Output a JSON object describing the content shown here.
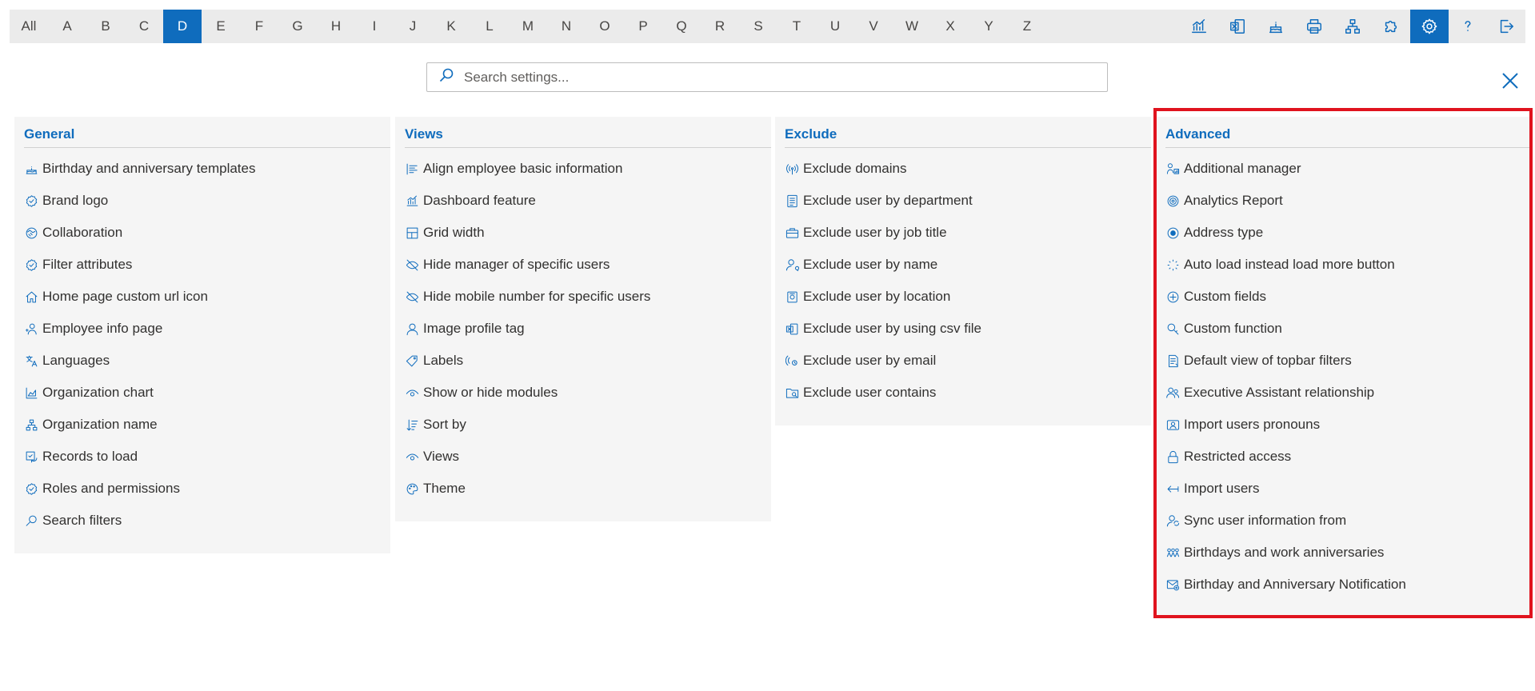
{
  "alphabet": {
    "letters": [
      "All",
      "A",
      "B",
      "C",
      "D",
      "E",
      "F",
      "G",
      "H",
      "I",
      "J",
      "K",
      "L",
      "M",
      "N",
      "O",
      "P",
      "Q",
      "R",
      "S",
      "T",
      "U",
      "V",
      "W",
      "X",
      "Y",
      "Z"
    ],
    "active": "D"
  },
  "toolbar": {
    "icons": [
      "analytics-icon",
      "excel-export-icon",
      "birthday-cake-icon",
      "print-icon",
      "org-chart-icon",
      "puzzle-icon",
      "settings-gear-icon",
      "help-icon",
      "sign-out-icon"
    ],
    "active": "settings-gear-icon"
  },
  "search": {
    "placeholder": "Search settings..."
  },
  "colors": {
    "accent": "#0f6cbd",
    "highlight": "#e0131e",
    "panel_bg": "#f5f5f5"
  },
  "sections": [
    {
      "title": "General",
      "items": [
        {
          "label": "Birthday and anniversary templates",
          "icon": "cake-icon"
        },
        {
          "label": "Brand logo",
          "icon": "badge-check-icon"
        },
        {
          "label": "Collaboration",
          "icon": "handshake-icon"
        },
        {
          "label": "Filter attributes",
          "icon": "badge-check-icon"
        },
        {
          "label": "Home page custom url icon",
          "icon": "home-icon"
        },
        {
          "label": "Employee info page",
          "icon": "person-link-icon"
        },
        {
          "label": "Languages",
          "icon": "translate-icon"
        },
        {
          "label": "Organization chart",
          "icon": "area-chart-icon"
        },
        {
          "label": "Organization name",
          "icon": "org-chart-icon"
        },
        {
          "label": "Records to load",
          "icon": "records-refresh-icon"
        },
        {
          "label": "Roles and permissions",
          "icon": "badge-check-icon"
        },
        {
          "label": "Search filters",
          "icon": "search-icon"
        }
      ]
    },
    {
      "title": "Views",
      "items": [
        {
          "label": "Align employee basic information",
          "icon": "align-left-icon"
        },
        {
          "label": "Dashboard feature",
          "icon": "analytics-icon"
        },
        {
          "label": "Grid width",
          "icon": "grid-icon"
        },
        {
          "label": "Hide manager of specific users",
          "icon": "eye-off-icon"
        },
        {
          "label": "Hide mobile number for specific users",
          "icon": "eye-off-icon"
        },
        {
          "label": "Image profile tag",
          "icon": "person-icon"
        },
        {
          "label": "Labels",
          "icon": "tag-icon"
        },
        {
          "label": "Show or hide modules",
          "icon": "eye-icon"
        },
        {
          "label": "Sort by",
          "icon": "sort-icon"
        },
        {
          "label": "Views",
          "icon": "eye-icon"
        },
        {
          "label": "Theme",
          "icon": "palette-icon"
        }
      ]
    },
    {
      "title": "Exclude",
      "items": [
        {
          "label": "Exclude domains",
          "icon": "broadcast-icon"
        },
        {
          "label": "Exclude user by department",
          "icon": "document-icon"
        },
        {
          "label": "Exclude user by job title",
          "icon": "briefcase-icon"
        },
        {
          "label": "Exclude user by name",
          "icon": "person-search-icon"
        },
        {
          "label": "Exclude user by location",
          "icon": "building-icon"
        },
        {
          "label": "Exclude user by using csv file",
          "icon": "excel-icon"
        },
        {
          "label": "Exclude user by email",
          "icon": "broadcast-email-icon"
        },
        {
          "label": "Exclude user contains",
          "icon": "folder-search-icon"
        }
      ]
    },
    {
      "title": "Advanced",
      "items": [
        {
          "label": "Additional manager",
          "icon": "people-chart-icon"
        },
        {
          "label": "Analytics Report",
          "icon": "target-icon"
        },
        {
          "label": "Address type",
          "icon": "radio-icon"
        },
        {
          "label": "Auto load instead load more button",
          "icon": "spinner-icon"
        },
        {
          "label": "Custom fields",
          "icon": "add-circle-icon"
        },
        {
          "label": "Custom function",
          "icon": "search-key-icon"
        },
        {
          "label": "Default view of topbar filters",
          "icon": "document-list-icon"
        },
        {
          "label": "Executive Assistant relationship",
          "icon": "people-icon"
        },
        {
          "label": "Import users pronouns",
          "icon": "person-card-icon"
        },
        {
          "label": "Restricted access",
          "icon": "lock-icon"
        },
        {
          "label": "Import users",
          "icon": "arrow-left-icon"
        },
        {
          "label": "Sync user information from",
          "icon": "person-sync-icon"
        },
        {
          "label": "Birthdays and work anniversaries",
          "icon": "people-celebrate-icon"
        },
        {
          "label": "Birthday and Anniversary Notification",
          "icon": "mail-settings-icon"
        }
      ]
    }
  ]
}
